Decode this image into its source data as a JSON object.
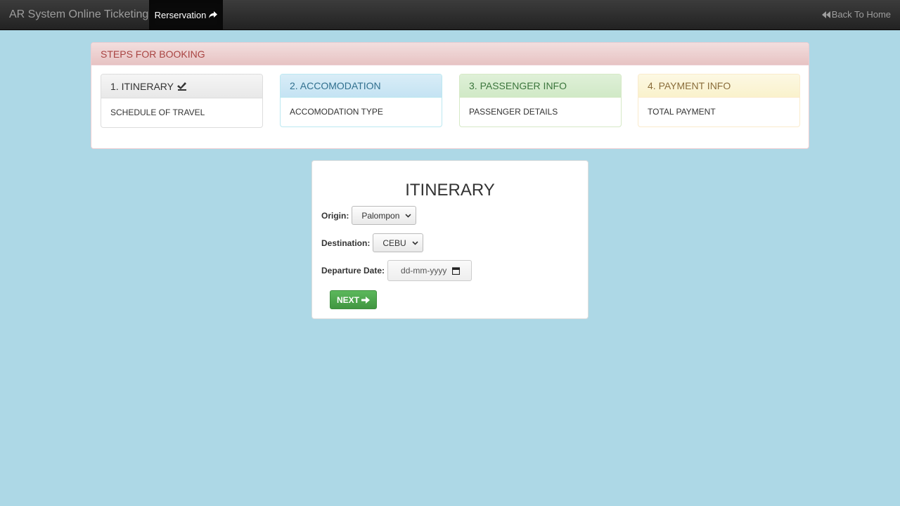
{
  "navbar": {
    "brand": "AR System Online Ticketing",
    "active_item": "Rerservation",
    "active_icon": "share-arrow-icon",
    "back_home": "Back To Home",
    "back_icon": "backward-icon"
  },
  "steps": {
    "heading": "STEPS FOR BOOKING",
    "items": [
      {
        "title": "1. ITINERARY",
        "body": "SCHEDULE OF TRAVEL",
        "icon": "check-edit-icon",
        "color": "#333333"
      },
      {
        "title": "2. ACCOMODATION",
        "body": "ACCOMODATION TYPE",
        "color": "#31708f"
      },
      {
        "title": "3. PASSENGER INFO",
        "body": "PASSENGER DETAILS",
        "color": "#3c763d"
      },
      {
        "title": "4. PAYMENT INFO",
        "body": "TOTAL PAYMENT",
        "color": "#8a6d3b"
      }
    ]
  },
  "form": {
    "title": "ITINERARY",
    "origin_label": "Origin:",
    "origin_value": "Palompon",
    "destination_label": "Destination:",
    "destination_value": "CEBU",
    "date_label": "Departure Date:",
    "date_placeholder": "dd-mm-yyyy",
    "next_label": "NEXT",
    "next_color": "#5cb85c"
  },
  "colors": {
    "page_background": "#add8e6",
    "navbar": "#222222",
    "steps_heading": "#a94442"
  }
}
